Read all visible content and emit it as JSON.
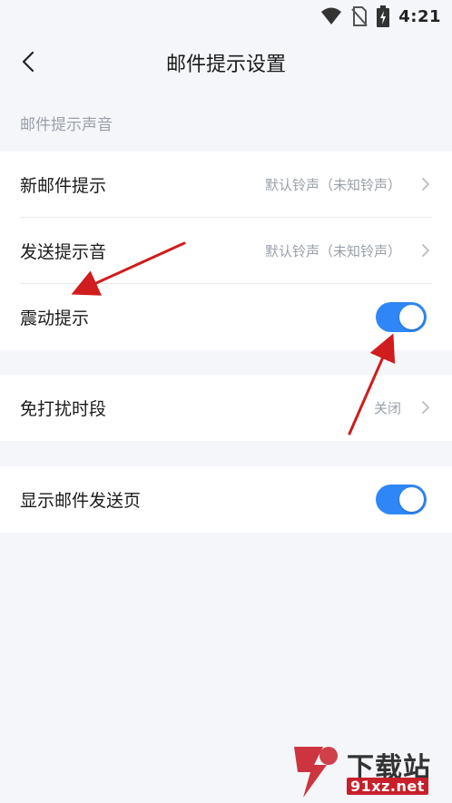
{
  "status_bar": {
    "time": "4:21",
    "icons": [
      "wifi-icon",
      "no-sim-icon",
      "battery-charging-icon"
    ]
  },
  "header": {
    "title": "邮件提示设置",
    "back_icon": "chevron-left-icon"
  },
  "section": {
    "label": "邮件提示声音"
  },
  "group1": {
    "rows": [
      {
        "label": "新邮件提示",
        "value": "默认铃声（未知铃声）"
      },
      {
        "label": "发送提示音",
        "value": "默认铃声（未知铃声）"
      },
      {
        "label": "震动提示",
        "toggle_on": true
      }
    ]
  },
  "group2": {
    "rows": [
      {
        "label": "免打扰时段",
        "value": "关闭"
      }
    ]
  },
  "group3": {
    "rows": [
      {
        "label": "显示邮件发送页",
        "toggle_on": true
      }
    ]
  },
  "watermark": {
    "text": "下载站",
    "url": "91xz.net"
  },
  "colors": {
    "accent": "#2f86f6",
    "background": "#f5f6fa",
    "annotation_arrow": "#d01c1c"
  }
}
